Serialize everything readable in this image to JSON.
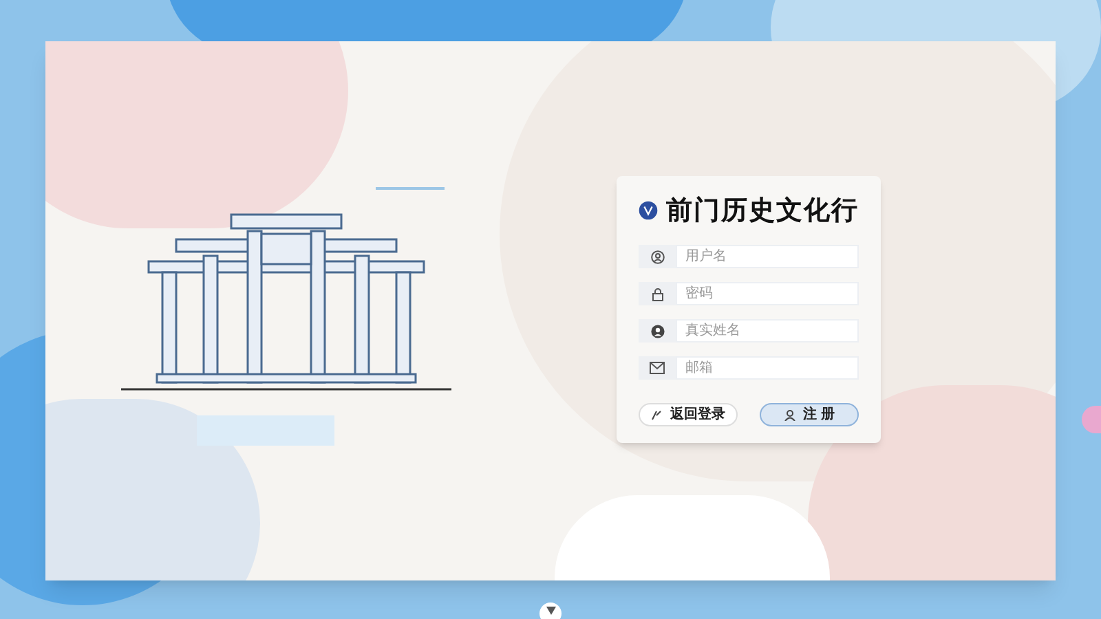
{
  "title": "前门历史文化行",
  "fields": [
    {
      "kind": "user",
      "placeholder": "用户名"
    },
    {
      "kind": "lock",
      "placeholder": "密码"
    },
    {
      "kind": "person",
      "placeholder": "真实姓名"
    },
    {
      "kind": "mail",
      "placeholder": "邮箱"
    }
  ],
  "buttons": [
    {
      "kind": "back",
      "label": "返回登录",
      "selected": false
    },
    {
      "kind": "register",
      "label": "注 册",
      "selected": true
    }
  ]
}
